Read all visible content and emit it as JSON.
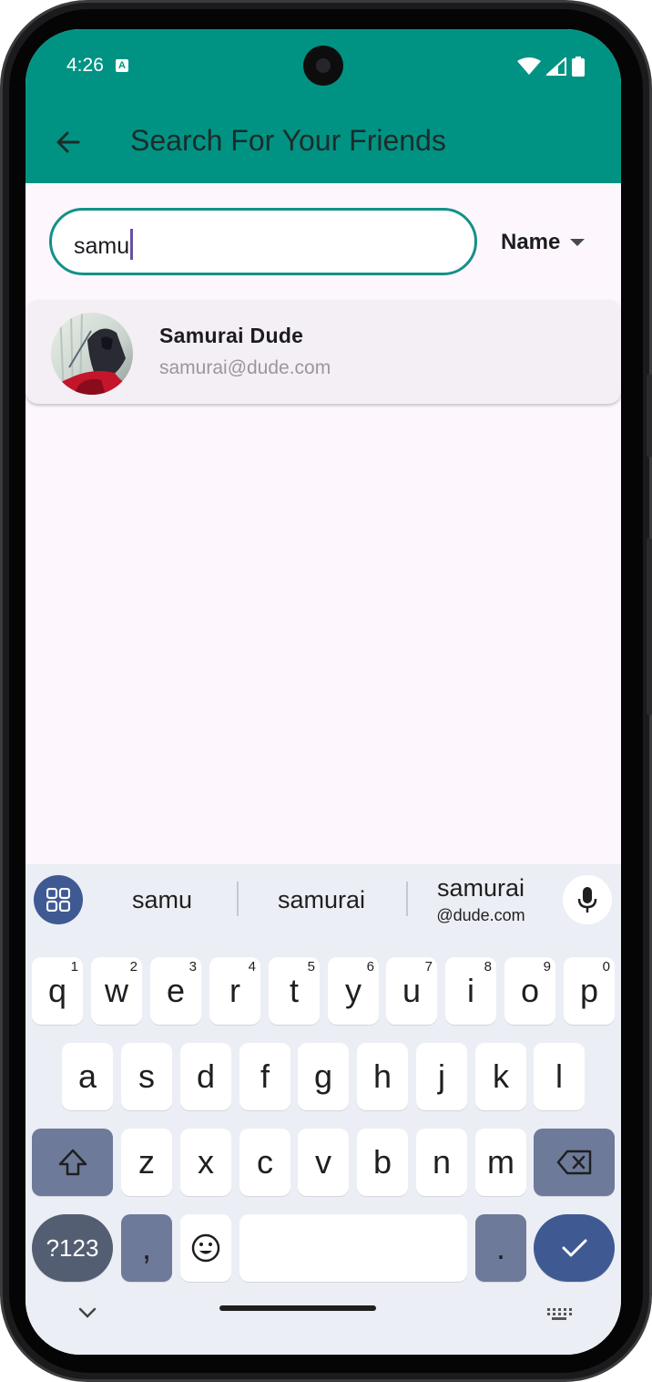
{
  "status_bar": {
    "time": "4:26",
    "notification_icon": "A",
    "icons": [
      "wifi-icon",
      "signal-icon",
      "battery-icon"
    ]
  },
  "app_bar": {
    "title": "Search For Your Friends",
    "back_icon": "arrow-back-icon",
    "color": "#009384"
  },
  "search": {
    "value": "samu",
    "filter": {
      "selected": "Name"
    }
  },
  "results": [
    {
      "name": "Samurai Dude",
      "email": "samurai@dude.com",
      "avatar": "samurai-avatar"
    }
  ],
  "keyboard": {
    "suggestions": [
      {
        "text": "samu"
      },
      {
        "text": "samurai"
      },
      {
        "text": "samurai",
        "sub": "@dude.com"
      }
    ],
    "row1": [
      {
        "key": "q",
        "hint": "1"
      },
      {
        "key": "w",
        "hint": "2"
      },
      {
        "key": "e",
        "hint": "3"
      },
      {
        "key": "r",
        "hint": "4"
      },
      {
        "key": "t",
        "hint": "5"
      },
      {
        "key": "y",
        "hint": "6"
      },
      {
        "key": "u",
        "hint": "7"
      },
      {
        "key": "i",
        "hint": "8"
      },
      {
        "key": "o",
        "hint": "9"
      },
      {
        "key": "p",
        "hint": "0"
      }
    ],
    "row2": [
      "a",
      "s",
      "d",
      "f",
      "g",
      "h",
      "j",
      "k",
      "l"
    ],
    "row3": [
      "z",
      "x",
      "c",
      "v",
      "b",
      "n",
      "m"
    ],
    "symbols_label": "?123",
    "comma": ",",
    "period": "."
  }
}
